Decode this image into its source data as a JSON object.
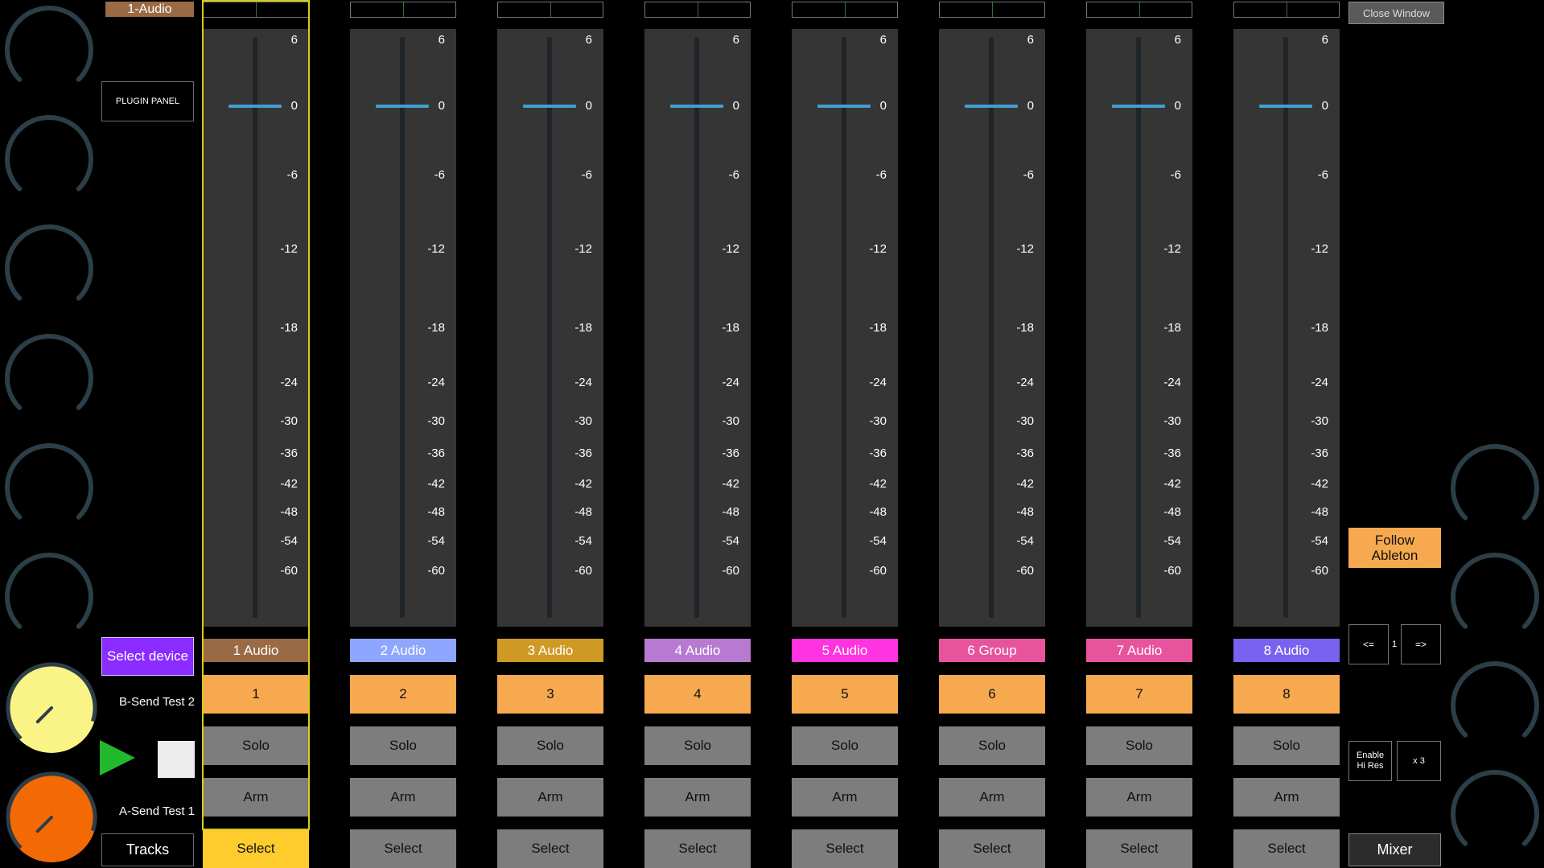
{
  "colors": {
    "accent_orange": "#f7a94f",
    "select_active": "#ffcc2e",
    "button_gray": "#7d7d7d",
    "fader_blue": "#3fa0d0",
    "selected_frame": "#d6cc1e",
    "knob_yellow": "#f9f485",
    "knob_orange": "#f36a05",
    "select_device_purple": "#8a2bff",
    "play_green": "#22b82b"
  },
  "left_panel": {
    "selected_track": {
      "label": "1-Audio",
      "color": "#9a6a44"
    },
    "plugin_panel_label": "PLUGIN PANEL",
    "select_device_label": "Select device",
    "send_b_label": "B-Send Test 2",
    "send_a_label": "A-Send Test 1",
    "tracks_label": "Tracks",
    "knob_icons": [
      "knob-icon",
      "knob-icon",
      "knob-icon",
      "knob-icon",
      "knob-icon",
      "knob-icon"
    ],
    "send_b_knob_level": 0.9,
    "send_a_knob_level": 0.9
  },
  "fader_scale": [
    "6",
    "0",
    "-6",
    "-12",
    "-18",
    "-24",
    "-30",
    "-36",
    "-42",
    "-48",
    "-54",
    "-60"
  ],
  "tracks": [
    {
      "name": "1 Audio",
      "color": "#9a6a44",
      "number": "1",
      "solo": "Solo",
      "arm": "Arm",
      "select": "Select",
      "selected": true,
      "volume_db": 0
    },
    {
      "name": "2 Audio",
      "color": "#8fa6ff",
      "number": "2",
      "solo": "Solo",
      "arm": "Arm",
      "select": "Select",
      "selected": false,
      "volume_db": 0
    },
    {
      "name": "3 Audio",
      "color": "#cf9a24",
      "number": "3",
      "solo": "Solo",
      "arm": "Arm",
      "select": "Select",
      "selected": false,
      "volume_db": 0
    },
    {
      "name": "4 Audio",
      "color": "#b77ad0",
      "number": "4",
      "solo": "Solo",
      "arm": "Arm",
      "select": "Select",
      "selected": false,
      "volume_db": 0
    },
    {
      "name": "5 Audio",
      "color": "#ff33e0",
      "number": "5",
      "solo": "Solo",
      "arm": "Arm",
      "select": "Select",
      "selected": false,
      "volume_db": 0
    },
    {
      "name": "6 Group",
      "color": "#e8539e",
      "number": "6",
      "solo": "Solo",
      "arm": "Arm",
      "select": "Select",
      "selected": false,
      "volume_db": 0
    },
    {
      "name": "7 Audio",
      "color": "#e8539e",
      "number": "7",
      "solo": "Solo",
      "arm": "Arm",
      "select": "Select",
      "selected": false,
      "volume_db": 0
    },
    {
      "name": "8 Audio",
      "color": "#7a62f0",
      "number": "8",
      "solo": "Solo",
      "arm": "Arm",
      "select": "Select",
      "selected": false,
      "volume_db": 0
    }
  ],
  "right_panel": {
    "close_window_label": "Close Window",
    "follow_line1": "Follow",
    "follow_line2": "Ableton",
    "prev_label": "<=",
    "page_number": "1",
    "next_label": "=>",
    "hires_line1": "Enable",
    "hires_line2": "Hi Res",
    "multiplier_label": "x 3",
    "mixer_label": "Mixer",
    "knob_icons": [
      "knob-icon",
      "knob-icon",
      "knob-icon",
      "knob-icon"
    ]
  }
}
